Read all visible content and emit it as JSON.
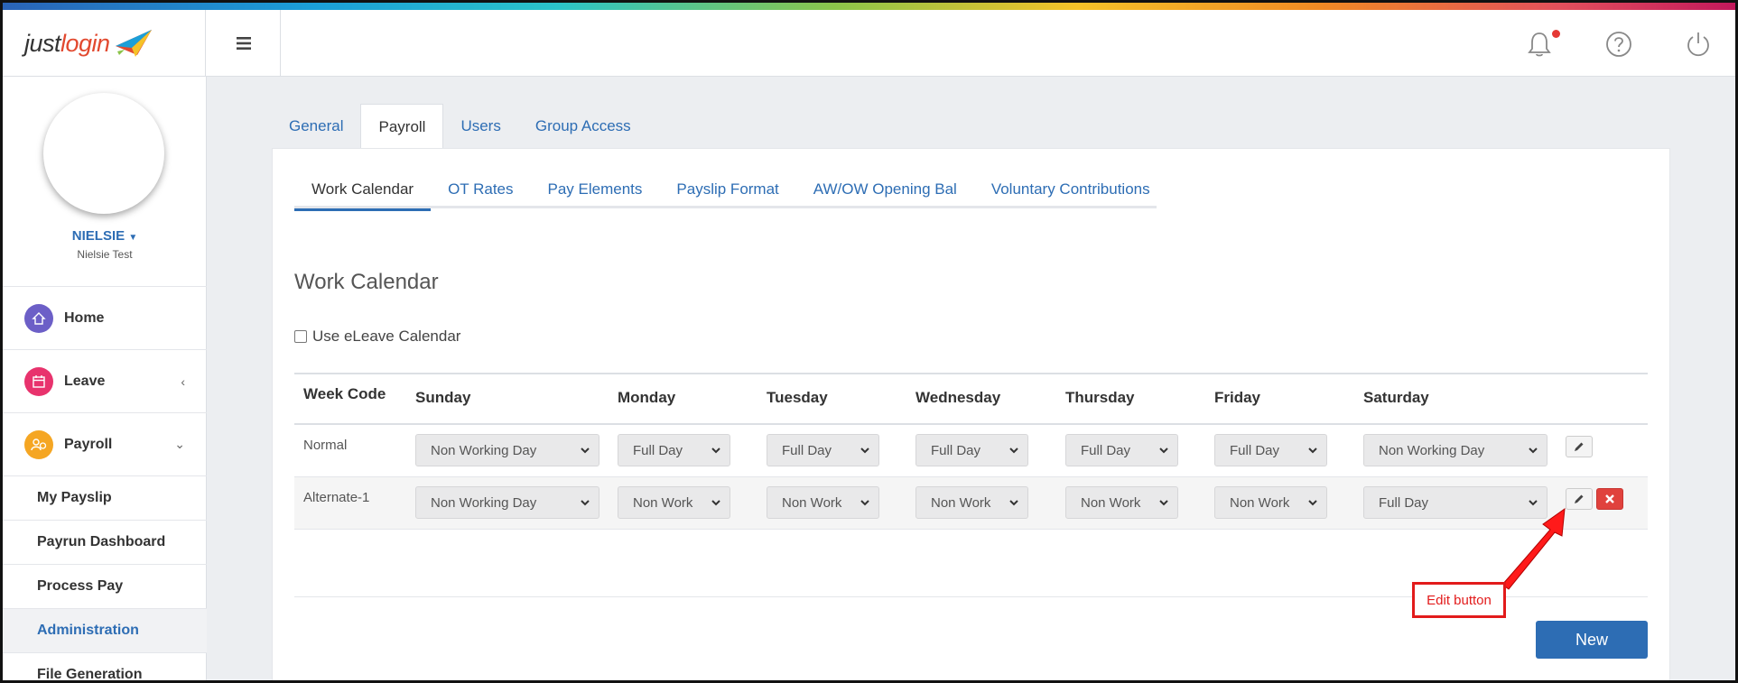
{
  "app": {
    "logo_part1": "just",
    "logo_part2": "login"
  },
  "topbar": {
    "menu_icon": "hamburger-icon",
    "notification_icon": "bell-icon",
    "help_icon": "help-circle-icon",
    "power_icon": "power-icon"
  },
  "user": {
    "username": "NIELSIE",
    "fullname": "Nielsie Test"
  },
  "sidebar": {
    "items": [
      {
        "label": "Home",
        "icon": "home-icon",
        "color": "#6c5fc7"
      },
      {
        "label": "Leave",
        "icon": "calendar-icon",
        "color": "#e8336d",
        "chevron": "‹"
      },
      {
        "label": "Payroll",
        "icon": "payroll-icon",
        "color": "#f5a623",
        "chevron": "⌄"
      }
    ],
    "subitems": [
      {
        "label": "My Payslip"
      },
      {
        "label": "Payrun Dashboard"
      },
      {
        "label": "Process Pay"
      },
      {
        "label": "Administration"
      },
      {
        "label": "File Generation"
      }
    ]
  },
  "tabs": [
    "General",
    "Payroll",
    "Users",
    "Group Access"
  ],
  "subtabs": [
    "Work Calendar",
    "OT Rates",
    "Pay Elements",
    "Payslip Format",
    "AW/OW Opening Bal",
    "Voluntary Contributions"
  ],
  "page": {
    "title": "Work Calendar",
    "checkbox_label": "Use eLeave Calendar"
  },
  "table": {
    "headers": [
      "Week Code",
      "Sunday",
      "Monday",
      "Tuesday",
      "Wednesday",
      "Thursday",
      "Friday",
      "Saturday"
    ],
    "rows": [
      {
        "code": "Normal",
        "days": [
          "Non Working Day",
          "Full Day",
          "Full Day",
          "Full Day",
          "Full Day",
          "Full Day",
          "Non Working Day"
        ]
      },
      {
        "code": "Alternate-1",
        "days": [
          "Non Working Day",
          "Non Work",
          "Non Work",
          "Non Work",
          "Non Work",
          "Non Work",
          "Full Day"
        ]
      }
    ]
  },
  "buttons": {
    "new": "New"
  },
  "annotation": {
    "callout": "Edit button",
    "color": "#e21b1b"
  }
}
